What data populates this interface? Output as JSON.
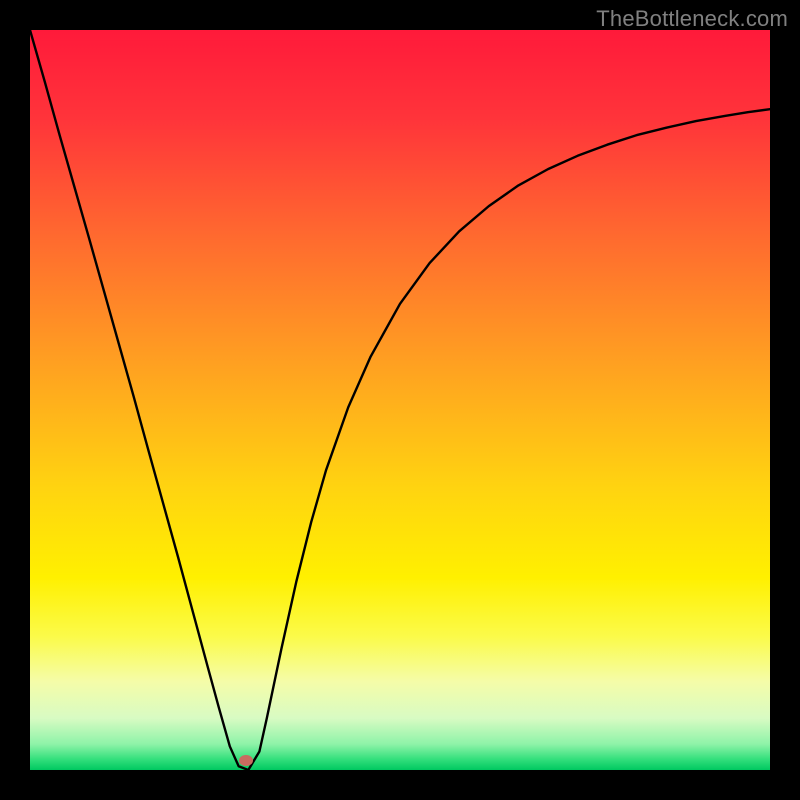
{
  "watermark": "TheBottleneck.com",
  "gradient_stops": [
    {
      "offset": 0.0,
      "color": "#ff1a3a"
    },
    {
      "offset": 0.12,
      "color": "#ff343a"
    },
    {
      "offset": 0.28,
      "color": "#ff6a2f"
    },
    {
      "offset": 0.45,
      "color": "#ffa021"
    },
    {
      "offset": 0.62,
      "color": "#ffd410"
    },
    {
      "offset": 0.74,
      "color": "#fff000"
    },
    {
      "offset": 0.82,
      "color": "#fbfb4a"
    },
    {
      "offset": 0.88,
      "color": "#f5fca8"
    },
    {
      "offset": 0.93,
      "color": "#d8fbc3"
    },
    {
      "offset": 0.965,
      "color": "#8ef3a8"
    },
    {
      "offset": 0.985,
      "color": "#35e07d"
    },
    {
      "offset": 1.0,
      "color": "#00c860"
    }
  ],
  "marker": {
    "x_frac": 0.292,
    "y_frac": 0.987,
    "color": "#c86b60"
  },
  "chart_data": {
    "type": "line",
    "title": "",
    "xlabel": "",
    "ylabel": "",
    "xlim": [
      0,
      1
    ],
    "ylim": [
      0,
      1
    ],
    "series": [
      {
        "name": "curve",
        "x": [
          0.0,
          0.02,
          0.04,
          0.06,
          0.08,
          0.1,
          0.12,
          0.14,
          0.16,
          0.18,
          0.2,
          0.22,
          0.24,
          0.255,
          0.27,
          0.282,
          0.295,
          0.31,
          0.32,
          0.34,
          0.36,
          0.38,
          0.4,
          0.43,
          0.46,
          0.5,
          0.54,
          0.58,
          0.62,
          0.66,
          0.7,
          0.74,
          0.78,
          0.82,
          0.86,
          0.9,
          0.94,
          0.97,
          1.0
        ],
        "y": [
          1.0,
          0.93,
          0.858,
          0.788,
          0.718,
          0.647,
          0.576,
          0.505,
          0.432,
          0.36,
          0.288,
          0.214,
          0.14,
          0.085,
          0.032,
          0.005,
          0.0,
          0.025,
          0.07,
          0.165,
          0.255,
          0.335,
          0.405,
          0.49,
          0.558,
          0.63,
          0.685,
          0.728,
          0.762,
          0.79,
          0.812,
          0.83,
          0.845,
          0.858,
          0.868,
          0.877,
          0.884,
          0.889,
          0.893
        ]
      }
    ],
    "annotations": [
      {
        "type": "marker",
        "x": 0.292,
        "y": 0.013,
        "label": "minimum"
      }
    ]
  }
}
